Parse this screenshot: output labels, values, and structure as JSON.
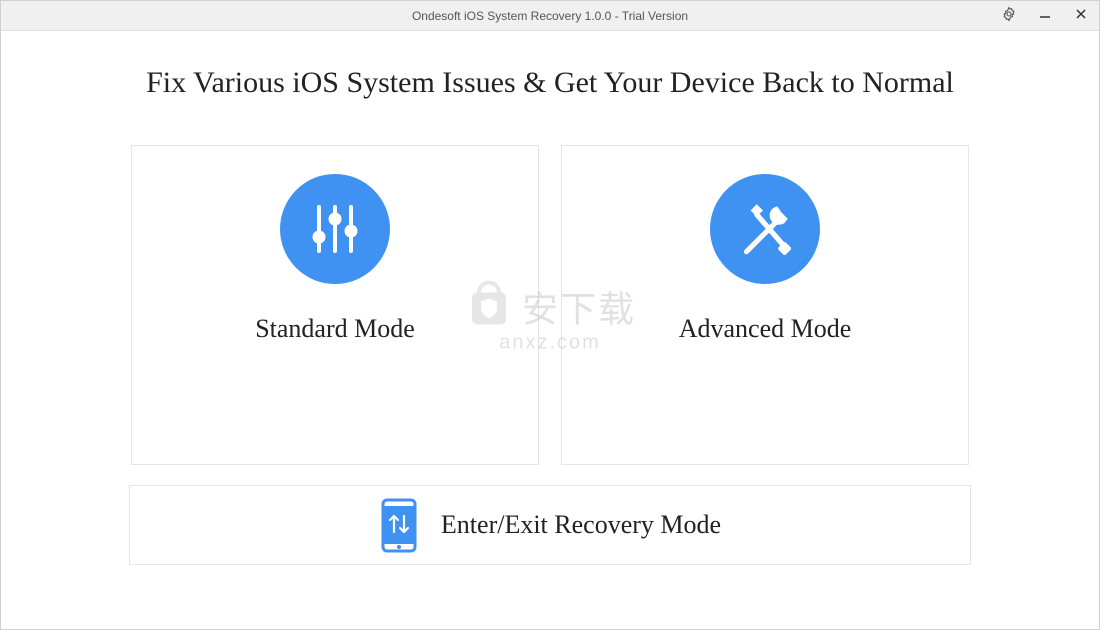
{
  "window": {
    "title": "Ondesoft iOS System Recovery 1.0.0 - Trial Version"
  },
  "heading": "Fix Various iOS System Issues & Get Your Device Back to Normal",
  "cards": {
    "standard": {
      "title": "Standard Mode"
    },
    "advanced": {
      "title": "Advanced Mode"
    }
  },
  "recovery": {
    "label": "Enter/Exit Recovery Mode"
  },
  "watermark": {
    "text": "安下载",
    "url": "anxz.com"
  },
  "colors": {
    "accent": "#4092f2"
  }
}
